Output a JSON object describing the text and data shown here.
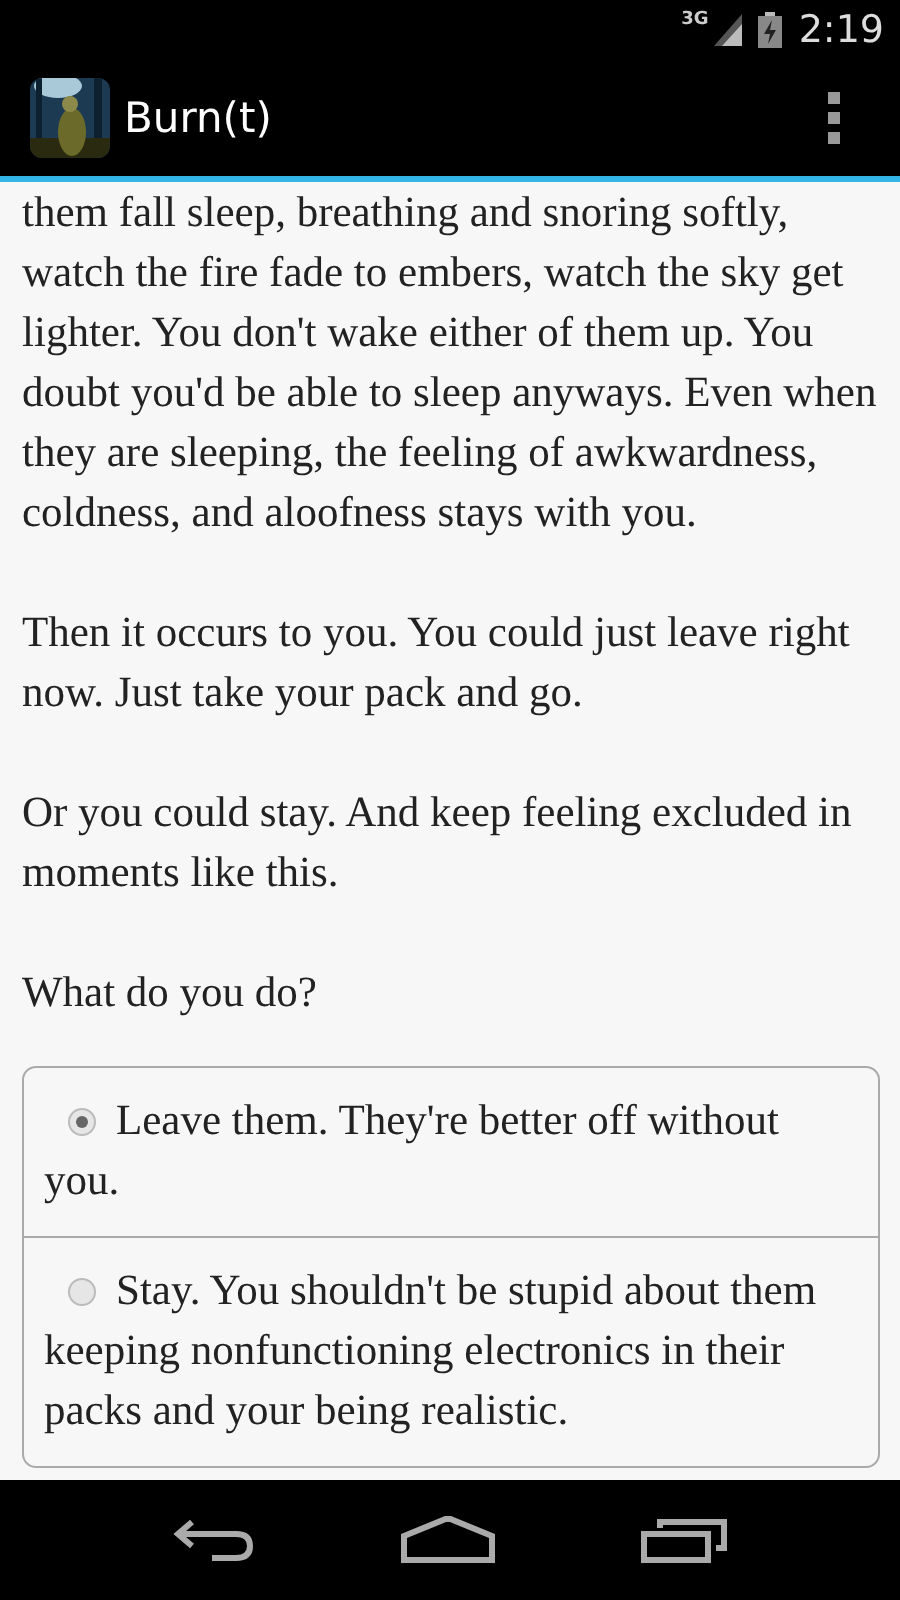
{
  "status_bar": {
    "network": "3G",
    "time": "2:19"
  },
  "action_bar": {
    "title": "Burn(t)"
  },
  "story": {
    "paragraphs": [
      "them fall sleep, breathing and snoring softly, watch the fire fade to embers, watch the sky get lighter. You don't wake either of them up. You doubt you'd be able to sleep anyways. Even when they are sleeping, the feeling of awkwardness, coldness, and aloofness stays with you.",
      "Then it occurs to you. You could just leave right now. Just take your pack and go.",
      "Or you could stay. And keep feeling excluded in moments like this.",
      "What do you do?"
    ],
    "choices": [
      {
        "label": "Leave them. They're better off without you.",
        "selected": true
      },
      {
        "label": "Stay. You shouldn't be stupid about them keeping nonfunctioning electronics in their packs and your being realistic.",
        "selected": false
      }
    ]
  }
}
